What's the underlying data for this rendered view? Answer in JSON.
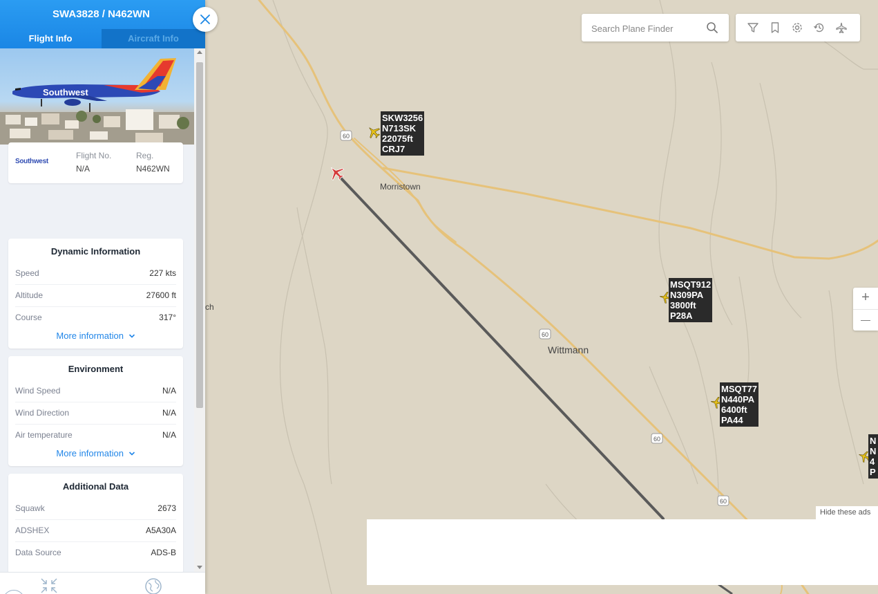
{
  "panel": {
    "title": "SWA3828 / N462WN",
    "tabs": {
      "flight_info": "Flight Info",
      "aircraft_info": "Aircraft Info"
    },
    "photo_livery_text": "Southwest",
    "identity": {
      "airline_logo_text": "Southwest",
      "flight_no_label": "Flight No.",
      "flight_no_value": "N/A",
      "reg_label": "Reg.",
      "reg_value": "N462WN"
    },
    "dynamic": {
      "title": "Dynamic Information",
      "rows": [
        {
          "label": "Speed",
          "value": "227 kts"
        },
        {
          "label": "Altitude",
          "value": "27600 ft"
        },
        {
          "label": "Course",
          "value": "317°"
        }
      ],
      "more": "More information"
    },
    "environment": {
      "title": "Environment",
      "rows": [
        {
          "label": "Wind Speed",
          "value": "N/A"
        },
        {
          "label": "Wind Direction",
          "value": "N/A"
        },
        {
          "label": "Air temperature",
          "value": "N/A"
        }
      ],
      "more": "More information"
    },
    "additional": {
      "title": "Additional Data",
      "rows": [
        {
          "label": "Squawk",
          "value": "2673"
        },
        {
          "label": "ADSHEX",
          "value": "A5A30A"
        },
        {
          "label": "Data Source",
          "value": "ADS-B"
        }
      ]
    }
  },
  "search": {
    "placeholder": "Search Plane Finder"
  },
  "map": {
    "places": {
      "morristown": "Morristown",
      "wittmann": "Wittmann",
      "clipped_edge": "ch"
    },
    "route_shield": "60",
    "aircraft": [
      {
        "lines": "SKW3256\nN713SK\n22075ft\nCRJ7"
      },
      {
        "lines": "MSQT912\nN309PA\n3800ft\nP28A"
      },
      {
        "lines": "MSQT77\nN440PA\n6400ft\nPA44"
      },
      {
        "lines": "N\nN\n4\nP"
      }
    ]
  },
  "zoom": {
    "in": "+",
    "out": "—"
  },
  "ads": {
    "hide": "Hide these ads"
  },
  "colors": {
    "accent": "#1a86e5",
    "selected_aircraft": "#d43a3a",
    "other_aircraft": "#e8c21a",
    "road": "#e6c27a",
    "track": "#5a5a5a"
  }
}
